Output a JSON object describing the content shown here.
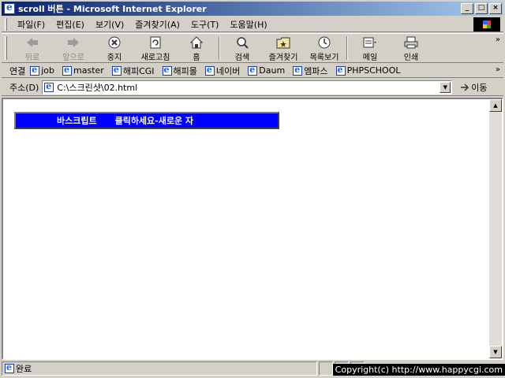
{
  "window": {
    "title": "scroll 버튼 - Microsoft Internet Explorer"
  },
  "title_buttons": {
    "minimize": "_",
    "maximize": "□",
    "close": "×"
  },
  "menu": [
    "파일(F)",
    "편집(E)",
    "보기(V)",
    "즐겨찾기(A)",
    "도구(T)",
    "도움말(H)"
  ],
  "toolbar": {
    "back": "뒤로",
    "forward": "앞으로",
    "stop": "중지",
    "refresh": "새로고침",
    "home": "홈",
    "search": "검색",
    "favorites": "즐겨찾기",
    "history": "목록보기",
    "mail": "메일",
    "print": "인쇄",
    "more": "»"
  },
  "links": {
    "label": "연결",
    "items": [
      "job",
      "master",
      "해피CGI",
      "해피몰",
      "네이버",
      "Daum",
      "엠파스",
      "PHPSCHOOL"
    ],
    "more": "»"
  },
  "address": {
    "label": "주소(D)",
    "value": "C:\\스크린샷\\02.html",
    "go": "이동"
  },
  "content": {
    "marquee_text": "바스크립트      클릭하세요-새로운 자"
  },
  "status": {
    "text": "완료"
  },
  "copyright": "Copyright(c) http://www.happycgi.com"
}
